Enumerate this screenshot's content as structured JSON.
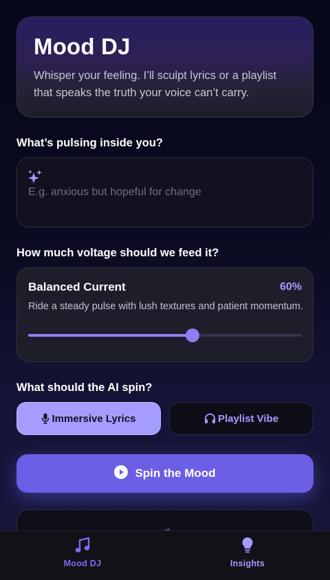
{
  "hero": {
    "title": "Mood DJ",
    "description": "Whisper your feeling. I’ll sculpt lyrics or a playlist that speaks the truth your voice can’t carry."
  },
  "mood": {
    "question": "What’s pulsing inside you?",
    "placeholder": "E.g. anxious but hopeful for change",
    "value": "",
    "icon": "sparkles-icon"
  },
  "voltage": {
    "question": "How much voltage should we feed it?",
    "level_name": "Balanced Current",
    "percent_label": "60%",
    "percent": 60,
    "description": "Ride a steady pulse with lush textures and patient momentum."
  },
  "mode": {
    "question": "What should the AI spin?",
    "options": [
      {
        "label": "Immersive Lyrics",
        "icon": "microphone-icon",
        "selected": true
      },
      {
        "label": "Playlist Vibe",
        "icon": "headphones-icon",
        "selected": false
      }
    ]
  },
  "spin": {
    "label": "Spin the Mood",
    "icon": "play-circle-icon"
  },
  "nav": {
    "items": [
      {
        "label": "Mood DJ",
        "icon": "music-note-icon",
        "active": true
      },
      {
        "label": "Insights",
        "icon": "lightbulb-icon",
        "active": false
      }
    ]
  },
  "colors": {
    "accent": "#6b5fe6",
    "accent_light": "#a49cff",
    "background": "#0b0b22",
    "card": "#1e1e2b"
  }
}
